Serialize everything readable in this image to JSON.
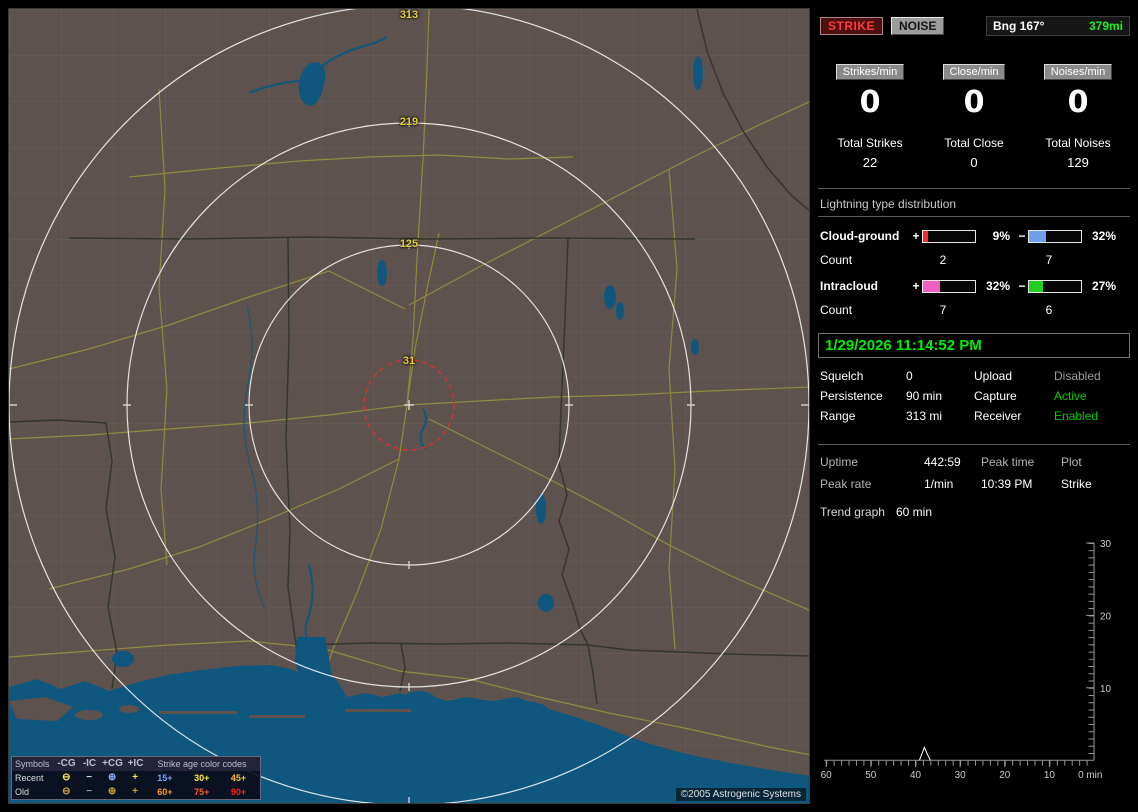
{
  "map": {
    "range_labels": {
      "r313": "313",
      "r219": "219",
      "r125": "125",
      "r31": "31"
    },
    "copyright": "©2005 Astrogenic Systems",
    "colors": {
      "land": "#5d524e",
      "water": "#10577f",
      "roads": "#8f8f3e",
      "rings": "#f2f2f2",
      "alarm_ring": "#e03030",
      "range_label": "#e3cf3e"
    },
    "legend": {
      "symbols_title": "Symbols",
      "cols": [
        "-CG",
        "-IC",
        "+CG",
        "+IC"
      ],
      "age_title": "Strike age color codes",
      "rows": [
        {
          "label": "Recent",
          "syms": [
            {
              "glyph": "⊖",
              "style": "color:#ffe44a"
            },
            {
              "glyph": "−",
              "style": "color:#d8d8d8"
            },
            {
              "glyph": "⊕",
              "style": "color:#8fb0ff"
            },
            {
              "glyph": "+",
              "style": "color:#ffe44a"
            }
          ],
          "ages": [
            {
              "label": "15+",
              "style": "color:#6fa8ff"
            },
            {
              "label": "30+",
              "style": "color:#ffee33"
            },
            {
              "label": "45+",
              "style": "color:#ffc233"
            }
          ]
        },
        {
          "label": "Old",
          "syms": [
            {
              "glyph": "⊖",
              "style": "color:#c9a42c"
            },
            {
              "glyph": "−",
              "style": "color:#9a9a9a"
            },
            {
              "glyph": "⊕",
              "style": "color:#c9a42c"
            },
            {
              "glyph": "+",
              "style": "color:#c9a42c"
            }
          ],
          "ages": [
            {
              "label": "60+",
              "style": "color:#ff9b2a"
            },
            {
              "label": "75+",
              "style": "color:#ff5d22"
            },
            {
              "label": "90+",
              "style": "color:#ff2222"
            }
          ]
        }
      ]
    }
  },
  "panel": {
    "strike_label": "STRIKE",
    "noise_label": "NOISE",
    "bng_label": "Bng 167°",
    "bng_range": "379mi",
    "counters": [
      {
        "label": "Strikes/min",
        "value": "0",
        "total_label": "Total Strikes",
        "total_value": "22"
      },
      {
        "label": "Close/min",
        "value": "0",
        "total_label": "Total Close",
        "total_value": "0"
      },
      {
        "label": "Noises/min",
        "value": "0",
        "total_label": "Total Noises",
        "total_value": "129"
      }
    ],
    "distribution_title": "Lightning type distribution",
    "distribution": [
      {
        "name": "Cloud-ground",
        "plus_sign": "+",
        "plus_pct": "9%",
        "plus_bar_style": "width:9%;background:#ff2828",
        "minus_sign": "−",
        "minus_pct": "32%",
        "minus_bar_style": "width:32%;background:#6f9fe8",
        "count_label": "Count",
        "plus_count": "2",
        "minus_count": "7"
      },
      {
        "name": "Intracloud",
        "plus_sign": "+",
        "plus_pct": "32%",
        "plus_bar_style": "width:32%;background:#f060c0",
        "minus_sign": "−",
        "minus_pct": "27%",
        "minus_bar_style": "width:27%;background:#20d020",
        "count_label": "Count",
        "plus_count": "7",
        "minus_count": "6"
      }
    ],
    "timestamp": "1/29/2026 11:14:52 PM",
    "settings": [
      {
        "k1": "Squelch",
        "v1": "0",
        "k2": "Upload",
        "v2": "Disabled",
        "v2_style": "color:#9c9c9c"
      },
      {
        "k1": "Persistence",
        "v1": "90 min",
        "k2": "Capture",
        "v2": "Active",
        "v2_style": "color:#00cc00"
      },
      {
        "k1": "Range",
        "v1": "313 mi",
        "k2": "Receiver",
        "v2": "Enabled",
        "v2_style": "color:#00cc00"
      }
    ],
    "stats": {
      "uptime_label": "Uptime",
      "uptime_value": "442:59",
      "peak_time_label": "Peak time",
      "plot_label": "Plot",
      "peak_rate_label": "Peak rate",
      "peak_rate_value": "1/min",
      "peak_time_value": "10:39 PM",
      "plot_value": "Strike",
      "trend_label": "Trend graph",
      "trend_value": "60 min"
    },
    "graph": {
      "type": "line",
      "y_ticks": [
        "30",
        "20",
        "10"
      ],
      "x_ticks": [
        "60",
        "50",
        "40",
        "30",
        "20",
        "10"
      ],
      "x_end_label": "0 min",
      "y_max": 30,
      "x_range_min": 60,
      "peak": {
        "minutes_ago": 38,
        "value": 1
      }
    }
  }
}
